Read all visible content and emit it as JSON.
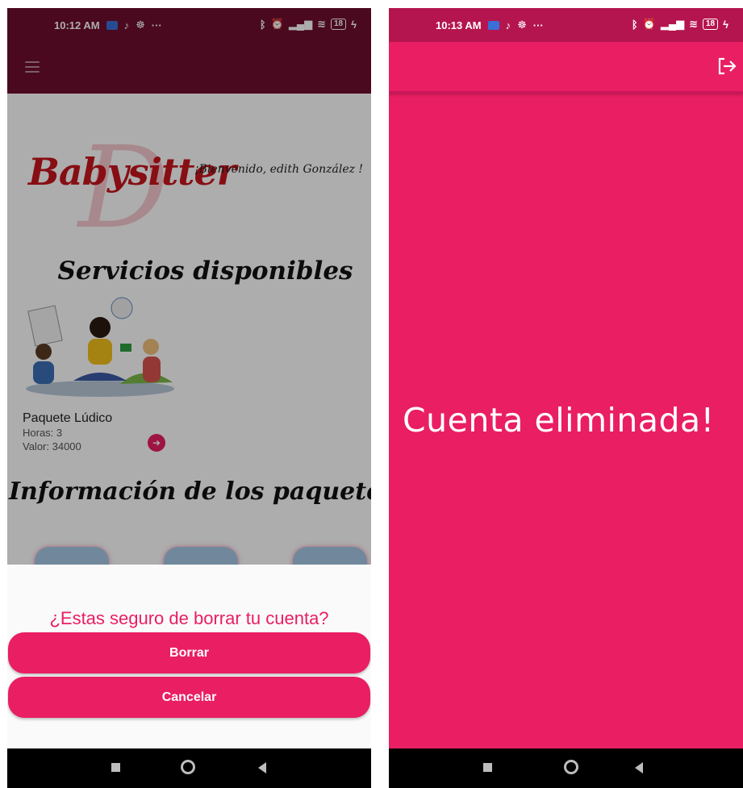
{
  "left_screen": {
    "status_bar": {
      "time": "10:12 AM",
      "more": "···",
      "battery": "18"
    },
    "header": {
      "menu_icon": "hamburger-icon"
    },
    "logo": {
      "text": "Babysitter",
      "letter": "D"
    },
    "welcome": "¡Bienvenido, edith González !",
    "services_title": "Servicios disponibles",
    "service_card": {
      "title": "Paquete Lúdico",
      "hours": "Horas: 3",
      "value": "Valor: 34000",
      "action_icon": "arrow-right-icon"
    },
    "info_title": "Información de los paquetes",
    "dialog": {
      "question": "¿Estas seguro de borrar tu cuenta?",
      "confirm_label": "Borrar",
      "cancel_label": "Cancelar"
    }
  },
  "right_screen": {
    "status_bar": {
      "time": "10:13 AM",
      "more": "···",
      "battery": "18"
    },
    "header": {
      "action_icon": "logout-icon"
    },
    "message": "Cuenta eliminada!"
  },
  "nav_bar": {
    "icons": [
      "recents-icon",
      "home-icon",
      "back-icon"
    ]
  },
  "colors": {
    "primary": "#e91e63",
    "dark_header": "#6e0e2d",
    "logo_red": "#c8161d",
    "nav": "#000000"
  }
}
